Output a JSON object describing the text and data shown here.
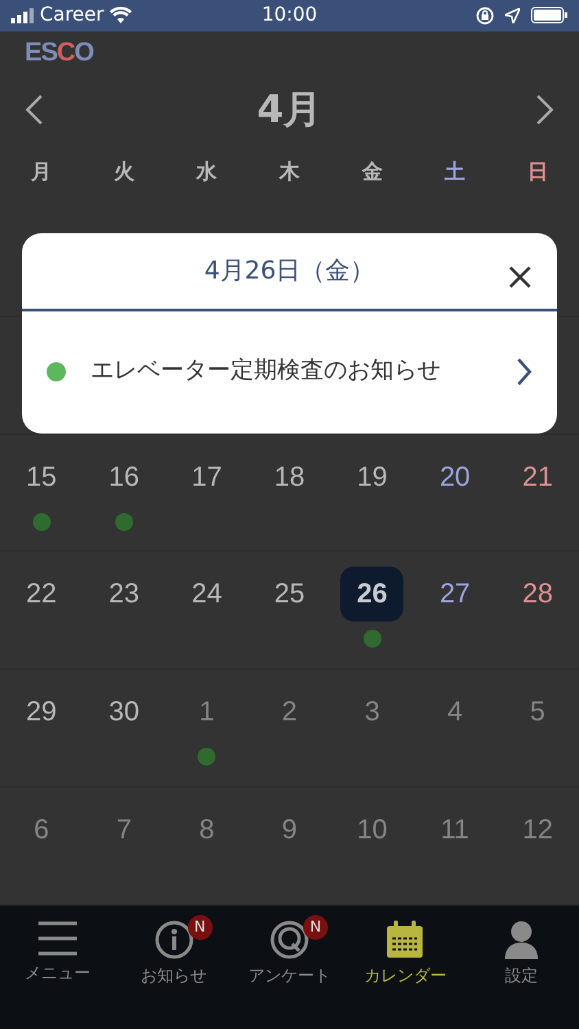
{
  "status_bar": {
    "carrier": "Career",
    "time": "10:00"
  },
  "logo": "ESCO",
  "calendar": {
    "month": "4月",
    "weekdays": [
      {
        "label": "月",
        "kind": "weekday"
      },
      {
        "label": "火",
        "kind": "weekday"
      },
      {
        "label": "水",
        "kind": "weekday"
      },
      {
        "label": "木",
        "kind": "weekday"
      },
      {
        "label": "金",
        "kind": "weekday"
      },
      {
        "label": "土",
        "kind": "saturday"
      },
      {
        "label": "日",
        "kind": "sunday"
      }
    ],
    "weeks": [
      {
        "days": [
          {
            "label": "15",
            "muted": false,
            "event": true,
            "selected": false
          },
          {
            "label": "16",
            "muted": false,
            "event": true,
            "selected": false
          },
          {
            "label": "17",
            "muted": false,
            "event": false,
            "selected": false
          },
          {
            "label": "18",
            "muted": false,
            "event": false,
            "selected": false
          },
          {
            "label": "19",
            "muted": false,
            "event": false,
            "selected": false
          },
          {
            "label": "20",
            "muted": false,
            "event": false,
            "selected": false
          },
          {
            "label": "21",
            "muted": false,
            "event": false,
            "selected": false
          }
        ]
      },
      {
        "days": [
          {
            "label": "22",
            "muted": false,
            "event": false,
            "selected": false
          },
          {
            "label": "23",
            "muted": false,
            "event": false,
            "selected": false
          },
          {
            "label": "24",
            "muted": false,
            "event": false,
            "selected": false
          },
          {
            "label": "25",
            "muted": false,
            "event": false,
            "selected": false
          },
          {
            "label": "26",
            "muted": false,
            "event": true,
            "selected": true
          },
          {
            "label": "27",
            "muted": false,
            "event": false,
            "selected": false
          },
          {
            "label": "28",
            "muted": false,
            "event": false,
            "selected": false
          }
        ]
      },
      {
        "days": [
          {
            "label": "29",
            "muted": false,
            "event": false,
            "selected": false
          },
          {
            "label": "30",
            "muted": false,
            "event": false,
            "selected": false
          },
          {
            "label": "1",
            "muted": true,
            "event": true,
            "selected": false
          },
          {
            "label": "2",
            "muted": true,
            "event": false,
            "selected": false
          },
          {
            "label": "3",
            "muted": true,
            "event": false,
            "selected": false
          },
          {
            "label": "4",
            "muted": true,
            "event": false,
            "selected": false
          },
          {
            "label": "5",
            "muted": true,
            "event": false,
            "selected": false
          }
        ]
      },
      {
        "days": [
          {
            "label": "6",
            "muted": true,
            "event": false,
            "selected": false
          },
          {
            "label": "7",
            "muted": true,
            "event": false,
            "selected": false
          },
          {
            "label": "8",
            "muted": true,
            "event": false,
            "selected": false
          },
          {
            "label": "9",
            "muted": true,
            "event": false,
            "selected": false
          },
          {
            "label": "10",
            "muted": true,
            "event": false,
            "selected": false
          },
          {
            "label": "11",
            "muted": true,
            "event": false,
            "selected": false
          },
          {
            "label": "12",
            "muted": true,
            "event": false,
            "selected": false
          }
        ]
      }
    ]
  },
  "modal": {
    "title": "4月26日（金）",
    "items": [
      {
        "text": "エレベーター定期検査のお知らせ",
        "color": "#5cb85c"
      }
    ]
  },
  "tab_bar": {
    "items": [
      {
        "kind": "menu",
        "label": "メニュー",
        "selected": false
      },
      {
        "kind": "info",
        "label": "お知らせ",
        "badge": "N",
        "selected": false
      },
      {
        "kind": "survey",
        "label": "アンケート",
        "badge": "N",
        "selected": false
      },
      {
        "kind": "calendar",
        "label": "カレンダー",
        "selected": true
      },
      {
        "kind": "settings",
        "label": "設定",
        "selected": false
      }
    ]
  }
}
